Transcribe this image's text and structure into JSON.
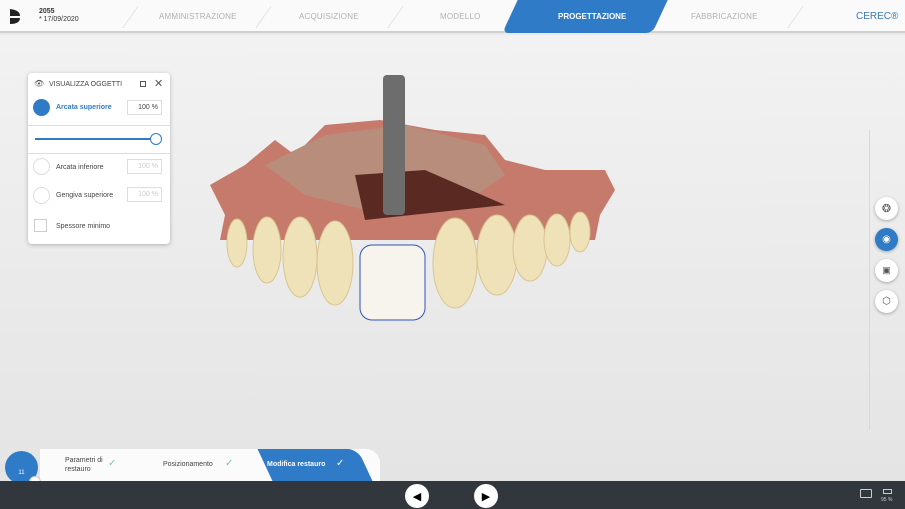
{
  "header": {
    "case_id": "2055",
    "case_date": "* 17/09/2020",
    "steps": [
      "AMMINISTRAZIONE",
      "ACQUISIZIONE",
      "MODELLO",
      "PROGETTAZIONE",
      "FABBRICAZIONE"
    ],
    "active_step": "PROGETTAZIONE",
    "brand": "CEREC®"
  },
  "panel": {
    "title": "VISUALIZZA OGGETTI",
    "items": [
      {
        "label": "Arcata superiore",
        "value": "100 %",
        "active": true
      },
      {
        "label": "Arcata inferiore",
        "value": "100 %"
      },
      {
        "label": "Gengiva superiore",
        "value": "100 %"
      }
    ],
    "slider_value": 100,
    "checkbox_label": "Spessore minimo",
    "checkbox_checked": false
  },
  "right_toolbar": [
    "model-icon",
    "eye-icon",
    "image-icon",
    "cube-icon"
  ],
  "workflow": {
    "tooth": "11",
    "steps": [
      {
        "label": "Parametri di restauro",
        "done": true
      },
      {
        "label": "Posizionamento",
        "done": true
      },
      {
        "label": "Modifica restauro",
        "done": true,
        "active": true
      }
    ]
  },
  "status": {
    "battery": "95 %"
  },
  "colors": {
    "accent": "#2f7bc8",
    "bottom_bar": "#32373e"
  }
}
